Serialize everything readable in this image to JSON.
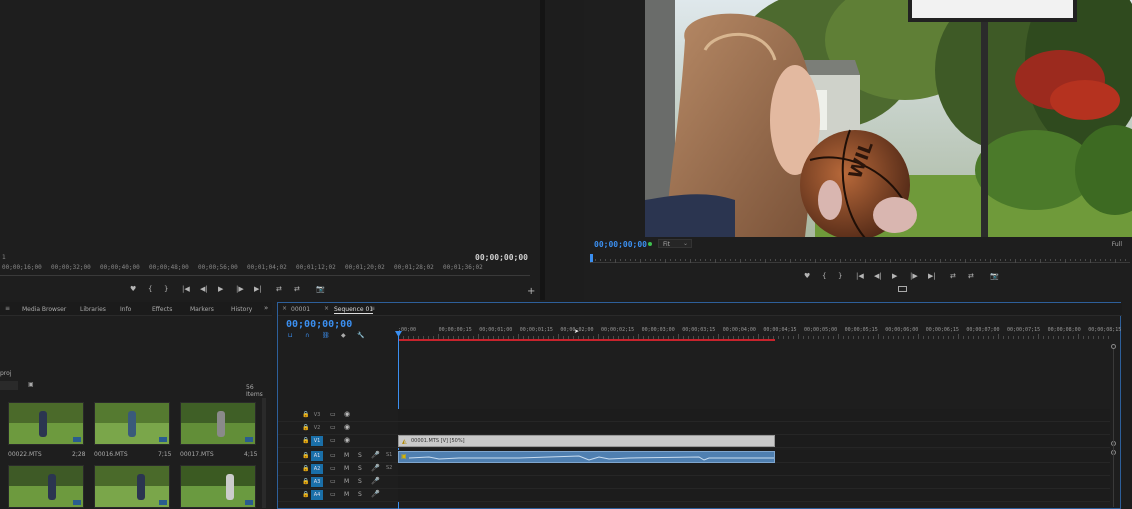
{
  "source_monitor": {
    "timecode": "00;00;00;00",
    "ruler_labels": [
      "00;00;16;00",
      "00;00;32;00",
      "00;00;40;00",
      "00;00;48;00",
      "00;00;56;00",
      "00;01;04;02",
      "00;01;12;02",
      "00;01;20;02",
      "00;01;28;02",
      "00;01;36;02"
    ],
    "playhead_label": "1",
    "controls": [
      "♥",
      "{",
      "}",
      "|◀",
      "◀|",
      "▶",
      "|▶",
      "▶|",
      "⇄",
      "⇄",
      "📷"
    ],
    "add_button": "+"
  },
  "program_monitor": {
    "timecode": "00;00;00;00",
    "fit_label": "Fit",
    "full_label": "Full",
    "controls": [
      "♥",
      "{",
      "}",
      "|◀",
      "◀|",
      "▶",
      "|▶",
      "▶|",
      "⇄",
      "⇄",
      "📷"
    ]
  },
  "project_panel": {
    "tabs": [
      "Media Browser",
      "Libraries",
      "Info",
      "Effects",
      "Markers",
      "History"
    ],
    "overflow": "»",
    "project_name": "proj",
    "items_count": "56 Items",
    "clips": [
      {
        "name": "00022.MTS",
        "duration": "2;28"
      },
      {
        "name": "00016.MTS",
        "duration": "7;15"
      },
      {
        "name": "00017.MTS",
        "duration": "4;15"
      },
      {
        "name": "",
        "duration": ""
      },
      {
        "name": "",
        "duration": ""
      },
      {
        "name": "",
        "duration": ""
      }
    ]
  },
  "timeline": {
    "tabs": [
      "00001",
      "Sequence 01"
    ],
    "timecode": "00;00;00;00",
    "ruler_labels": [
      ";00;00",
      "00;00;00;15",
      "00;00;01;00",
      "00;00;01;15",
      "00;00;02;00",
      "00;00;02;15",
      "00;00;03;00",
      "00;00;03;15",
      "00;00;04;00",
      "00;00;04;15",
      "00;00;05;00",
      "00;00;05;15",
      "00;00;06;00",
      "00;00;06;15",
      "00;00;07;00",
      "00;00;07;15",
      "00;00;08;00",
      "00;00;08;15"
    ],
    "video_tracks": [
      "V3",
      "V2",
      "V1"
    ],
    "audio_tracks": [
      "A1",
      "A2",
      "A3",
      "A4"
    ],
    "video_clip_label": "00001.MTS [V] [50%]",
    "audio_ch_labels": [
      "S1",
      "S2"
    ]
  },
  "colors": {
    "accent": "#3b8ff0",
    "target": "#1a6fa8",
    "work_area": "#c8232c",
    "clip_video": "#c9c9c9",
    "clip_audio": "#4f7fb0"
  }
}
